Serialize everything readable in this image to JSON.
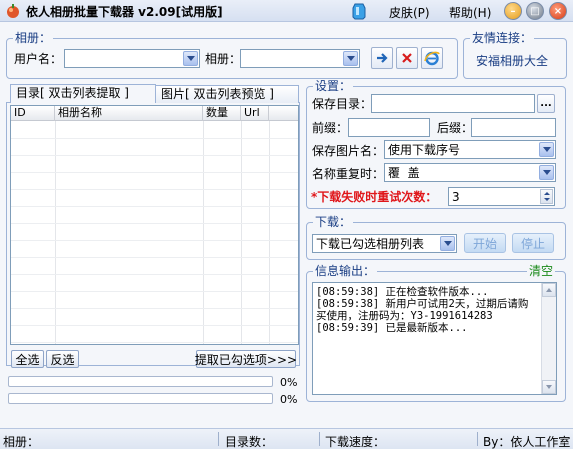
{
  "window": {
    "title": "依人相册批量下载器 v2.09[试用版]",
    "skin_menu": "皮肤(P)",
    "help_menu": "帮助(H)",
    "min_label": "–",
    "max_label": "□",
    "close_label": "×"
  },
  "album_group": {
    "legend": "相册：",
    "username_label": "用户名：",
    "username_value": "",
    "album_label": "相册：",
    "album_value": ""
  },
  "friend_group": {
    "legend": "友情连接：",
    "link_text": "安福相册大全"
  },
  "tabs": [
    {
      "label": "目录[ 双击列表提取 ]"
    },
    {
      "label": "图片[ 双击列表预览 ]"
    }
  ],
  "table": {
    "columns": [
      "ID",
      "相册名称",
      "数量",
      "Url"
    ],
    "rows": []
  },
  "list_buttons": {
    "select_all": "全选",
    "invert": "反选",
    "extract": "提取已勾选项>>>"
  },
  "progress": [
    {
      "percent": 0,
      "text": "0%"
    },
    {
      "percent": 0,
      "text": "0%"
    }
  ],
  "settings": {
    "legend": "设置：",
    "save_dir_label": "保存目录：",
    "save_dir_value": "",
    "browse_label": "...",
    "prefix_label": "前缀：",
    "prefix_value": "",
    "suffix_label": "后缀：",
    "suffix_value": "",
    "save_name_label": "保存图片名：",
    "save_name_value": "使用下载序号",
    "duplicate_label": "名称重复时：",
    "duplicate_value": "覆  盖",
    "retry_label": "*下载失败时重试次数：",
    "retry_value": "3"
  },
  "download": {
    "legend": "下载：",
    "mode_value": "下载已勾选相册列表",
    "start_label": "开始",
    "stop_label": "停止"
  },
  "info": {
    "legend": "信息输出：",
    "clear_label": "清空",
    "lines": [
      "[08:59:38] 正在检查软件版本...",
      "[08:59:38] 新用户可试用2天，过期后请购买使用，注册码为：Y3-1991614283",
      "[08:59:39] 已是最新版本..."
    ]
  },
  "statusbar": {
    "album_label": "相册：",
    "dir_count_label": "目录数：",
    "speed_label": "下载速度：",
    "author": "By：依人工作室"
  },
  "colors": {
    "accent": "#1a3e84",
    "warning": "#e0161a",
    "clear_link": "#1a8a1a"
  }
}
